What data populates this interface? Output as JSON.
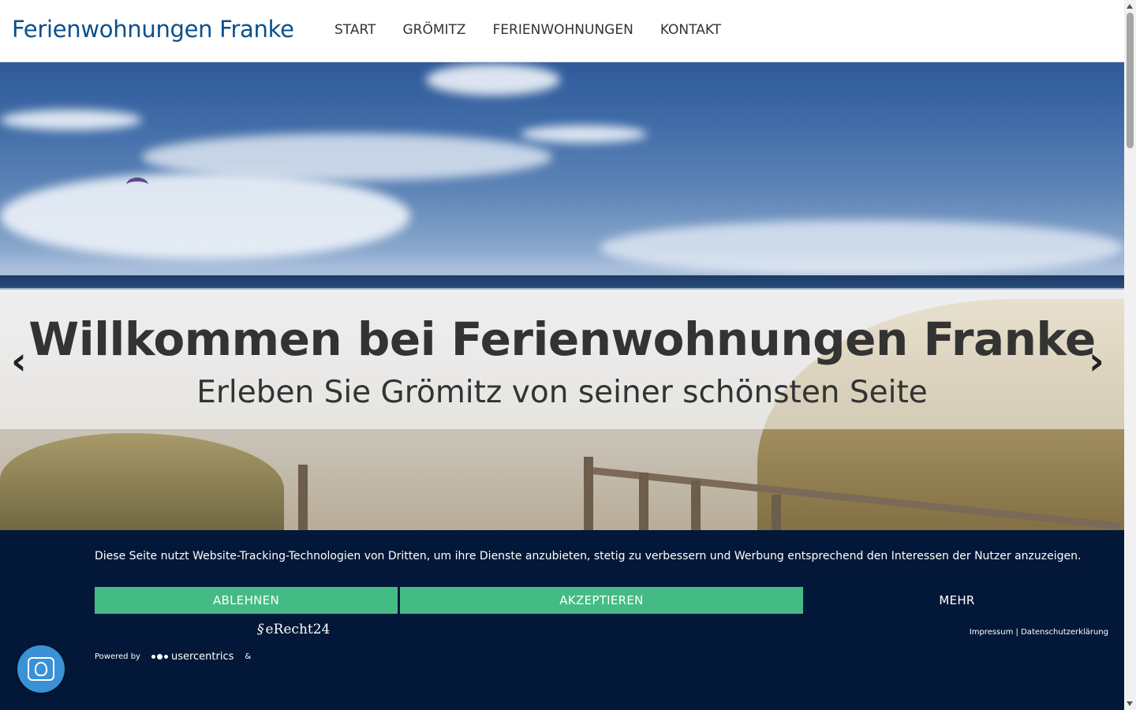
{
  "header": {
    "brand": "Ferienwohnungen Franke",
    "nav": [
      {
        "label": "START"
      },
      {
        "label": "GRÖMITZ"
      },
      {
        "label": "FERIENWOHNUNGEN"
      },
      {
        "label": "KONTAKT"
      }
    ]
  },
  "hero": {
    "title": "Willkommen bei Ferienwohnungen Franke",
    "subtitle": "Erleben Sie Grömitz von seiner schönsten Seite",
    "prev_icon": "‹",
    "next_icon": "›"
  },
  "cookie_banner": {
    "text": "Diese Seite nutzt Website-Tracking-Technologien von Dritten, um ihre Dienste anzubieten, stetig zu verbessern und Werbung entsprechend den Interessen der Nutzer anzuzeigen.",
    "decline_label": "ABLEHNEN",
    "accept_label": "AKZEPTIEREN",
    "more_label": "MEHR",
    "erecht_logo": "eRecht24",
    "impressum": "Impressum",
    "separator": "|",
    "privacy": "Datenschutzerklärung",
    "powered_by": "Powered by",
    "usercentrics_logo": "usercentrics",
    "ampersand": "&",
    "accent_color": "#44bb84",
    "background_color": "#031838"
  },
  "privacy_fab": {
    "icon": "fingerprint-icon"
  }
}
